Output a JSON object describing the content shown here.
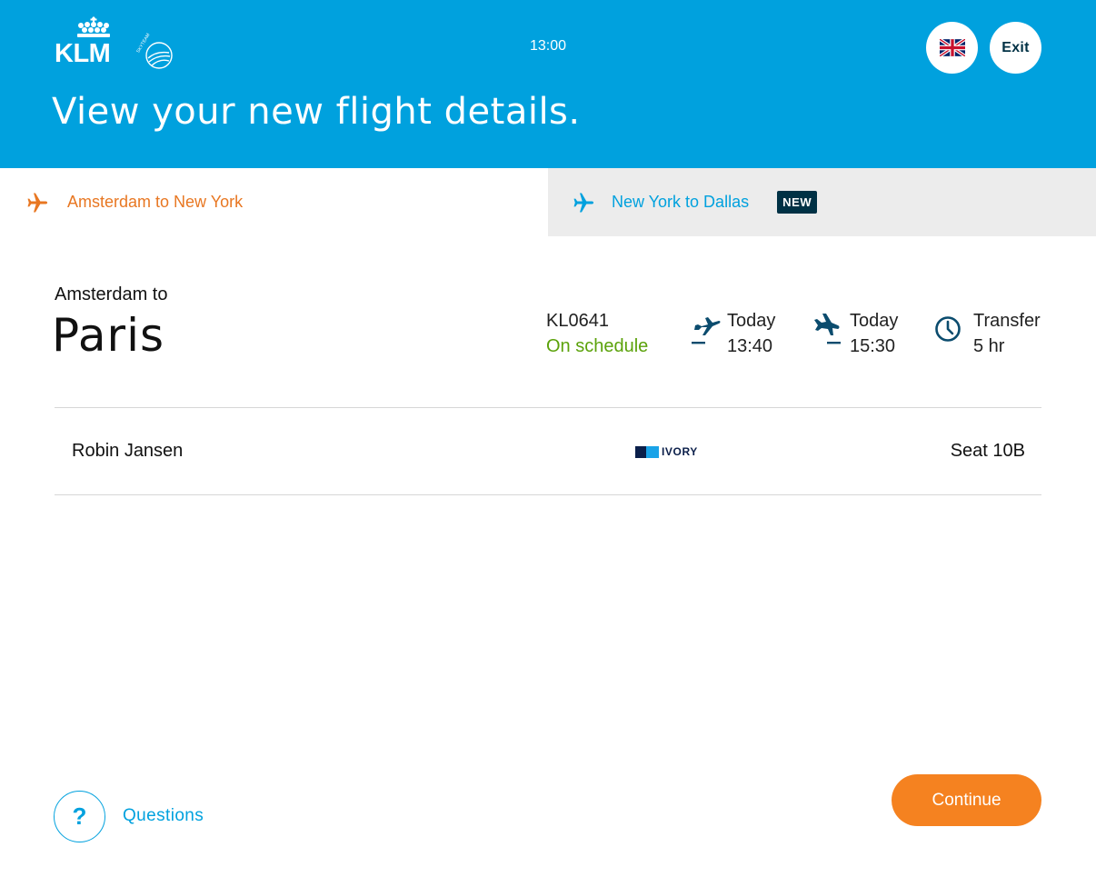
{
  "header": {
    "logo": {
      "brand": "KLM",
      "alliance": "SKYTEAM"
    },
    "time": "13:00",
    "language_icon": "uk-flag-icon",
    "exit_label": "Exit",
    "page_title": "View your new flight details."
  },
  "tabs": [
    {
      "label": "Amsterdam to New York",
      "icon": "plane-icon",
      "active": true,
      "color": "#e87722"
    },
    {
      "label": "New York to Dallas",
      "icon": "plane-icon",
      "active": false,
      "badge": "NEW",
      "color": "#00a1de"
    }
  ],
  "flight": {
    "route_from": "Amsterdam to",
    "route_to": "Paris",
    "flight_number": "KL0641",
    "status": "On schedule",
    "departure": {
      "day": "Today",
      "time": "13:40",
      "icon": "takeoff-icon"
    },
    "arrival": {
      "day": "Today",
      "time": "15:30",
      "icon": "landing-icon"
    },
    "transfer": {
      "label": "Transfer",
      "value": "5 hr",
      "icon": "clock-icon"
    }
  },
  "passenger": {
    "name": "Robin Jansen",
    "tier": "IVORY",
    "seat": "Seat 10B"
  },
  "footer": {
    "help_symbol": "?",
    "help_label": "Questions",
    "continue_label": "Continue"
  },
  "colors": {
    "brand_blue": "#00a1de",
    "accent_orange": "#f58220",
    "status_green": "#5ba20a",
    "dark_navy": "#003145"
  }
}
